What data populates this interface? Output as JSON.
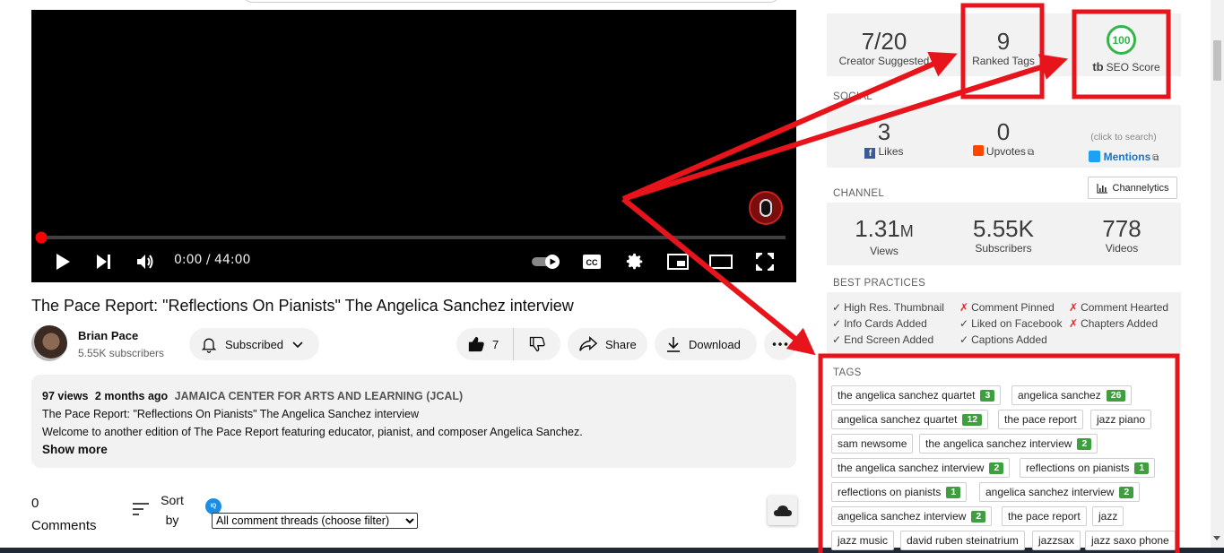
{
  "player": {
    "time": "0:00 / 44:00",
    "progress_fraction": 0.0
  },
  "video": {
    "title": "The Pace Report: \"Reflections On Pianists\" The Angelica Sanchez interview",
    "channel_name": "Brian Pace",
    "channel_subs": "5.55K subscribers",
    "subscribed_label": "Subscribed",
    "like_count": "7",
    "share_label": "Share",
    "download_label": "Download"
  },
  "description": {
    "views": "97 views",
    "age": "2 months ago",
    "org": "JAMAICA CENTER FOR ARTS AND LEARNING (JCAL)",
    "line1": "The Pace Report: \"Reflections On Pianists\" The Angelica Sanchez interview",
    "line2": "Welcome to another edition of The Pace Report featuring educator, pianist, and composer Angelica Sanchez.",
    "show_more": "Show more"
  },
  "comments": {
    "count": "0",
    "count_label": "Comments",
    "sort_label": "Sort by",
    "filter_selected": "All comment threads (choose filter)"
  },
  "panel": {
    "seo": {
      "creator_suggested_value": "7/20",
      "creator_suggested_label": "Creator Suggested",
      "ranked_tags_value": "9",
      "ranked_tags_label": "Ranked Tags",
      "seo_score_value": "100",
      "seo_score_label": "SEO Score",
      "brand_mark": "tb"
    },
    "social": {
      "section_label": "SOCIAL",
      "likes_value": "3",
      "likes_label": "Likes",
      "upvotes_value": "0",
      "upvotes_label": "Upvotes",
      "mentions_hint": "(click to search)",
      "mentions_label": "Mentions"
    },
    "channel": {
      "section_label": "CHANNEL",
      "channelytics_label": "Channelytics",
      "views_value": "1.31",
      "views_unit": "M",
      "views_label": "Views",
      "subs_value": "5.55K",
      "subs_label": "Subscribers",
      "videos_value": "778",
      "videos_label": "Videos"
    },
    "best_practices": {
      "section_label": "BEST PRACTICES",
      "items": [
        {
          "label": "High Res. Thumbnail",
          "ok": true,
          "mark": "✓"
        },
        {
          "label": "Comment Pinned",
          "ok": false,
          "mark": "✗"
        },
        {
          "label": "Comment Hearted",
          "ok": false,
          "mark": "✗"
        },
        {
          "label": "Info Cards Added",
          "ok": true,
          "mark": "✓"
        },
        {
          "label": "Liked on Facebook",
          "ok": true,
          "mark": "✓"
        },
        {
          "label": "Chapters Added",
          "ok": false,
          "mark": "✗"
        },
        {
          "label": "End Screen Added",
          "ok": true,
          "mark": "✓"
        },
        {
          "label": "Captions Added",
          "ok": true,
          "mark": "✓"
        }
      ]
    },
    "tags": {
      "section_label": "TAGS",
      "items": [
        {
          "label": "the angelica sanchez quartet",
          "rank": "3"
        },
        {
          "label": "angelica sanchez",
          "rank": "26"
        },
        {
          "label": "angelica sanchez quartet",
          "rank": "12"
        },
        {
          "label": "the pace report",
          "rank": ""
        },
        {
          "label": "jazz piano",
          "rank": ""
        },
        {
          "label": "sam newsome",
          "rank": ""
        },
        {
          "label": "the angelica sanchez interview",
          "rank": "2"
        },
        {
          "label": "the angelica sanchez interview",
          "rank": "2"
        },
        {
          "label": "reflections on pianists",
          "rank": "1"
        },
        {
          "label": "reflections on pianists",
          "rank": "1"
        },
        {
          "label": "angelica sanchez interview",
          "rank": "2"
        },
        {
          "label": "angelica sanchez interview",
          "rank": "2"
        },
        {
          "label": "the pace report",
          "rank": ""
        },
        {
          "label": "jazz",
          "rank": ""
        },
        {
          "label": "jazz music",
          "rank": ""
        },
        {
          "label": "david ruben steinatrium",
          "rank": ""
        },
        {
          "label": "jazzsax",
          "rank": ""
        },
        {
          "label": "jazz saxo phone",
          "rank": ""
        }
      ]
    }
  },
  "colors": {
    "annotation_red": "#e8141b",
    "score_green": "#33b54a",
    "rank_green": "#3f9e3f",
    "mentions_blue": "#1a73c6",
    "youtube_red": "#ff0000"
  }
}
